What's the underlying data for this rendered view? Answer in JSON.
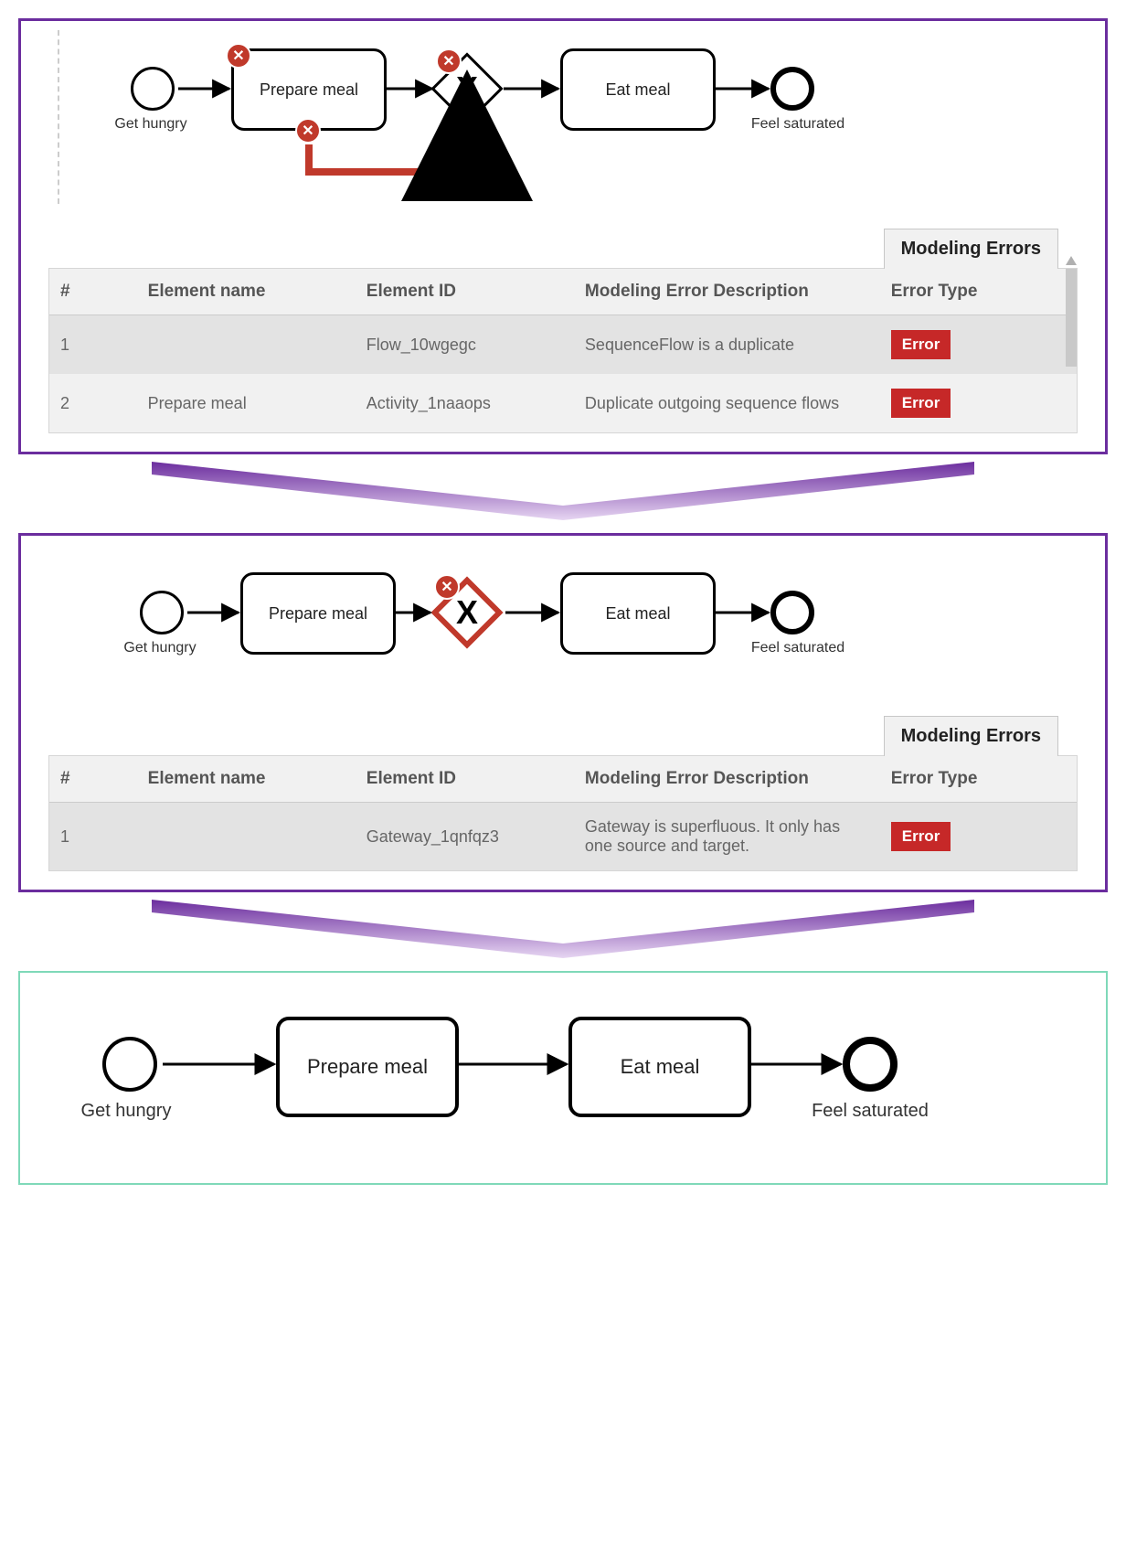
{
  "panel1": {
    "start_label": "Get hungry",
    "task_prepare": "Prepare meal",
    "task_eat": "Eat meal",
    "end_label": "Feel saturated",
    "gateway_symbol": "X",
    "tab_title": "Modeling Errors",
    "headers": {
      "num": "#",
      "name": "Element name",
      "id": "Element ID",
      "desc": "Modeling Error Description",
      "type": "Error Type"
    },
    "rows": [
      {
        "num": "1",
        "name": "",
        "id": "Flow_10wgegc",
        "desc": "SequenceFlow is a duplicate",
        "type": "Error"
      },
      {
        "num": "2",
        "name": "Prepare meal",
        "id": "Activity_1naaops",
        "desc": "Duplicate outgoing sequence flows",
        "type": "Error"
      }
    ]
  },
  "panel2": {
    "start_label": "Get hungry",
    "task_prepare": "Prepare meal",
    "task_eat": "Eat meal",
    "end_label": "Feel saturated",
    "gateway_symbol": "X",
    "tab_title": "Modeling Errors",
    "headers": {
      "num": "#",
      "name": "Element name",
      "id": "Element ID",
      "desc": "Modeling Error Description",
      "type": "Error Type"
    },
    "rows": [
      {
        "num": "1",
        "name": "",
        "id": "Gateway_1qnfqz3",
        "desc": "Gateway is superfluous. It only has one source and target.",
        "type": "Error"
      }
    ]
  },
  "panel3": {
    "start_label": "Get hungry",
    "task_prepare": "Prepare meal",
    "task_eat": "Eat meal",
    "end_label": "Feel saturated"
  },
  "icons": {
    "error_badge": "✕"
  }
}
